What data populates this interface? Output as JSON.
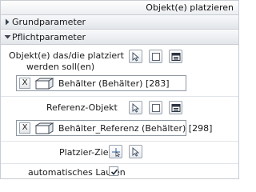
{
  "window": {
    "title": "Objekt(e) platzieren"
  },
  "sections": [
    {
      "label": "Grundparameter",
      "expanded": false
    },
    {
      "label": "Pflichtparameter",
      "expanded": true
    }
  ],
  "rows": {
    "objects": {
      "label_line1": "Objekt(e) das/die platziert",
      "label_line2": "werden soll(en)",
      "value": "Behälter (Behälter) [283]",
      "clear_label": "X"
    },
    "reference": {
      "label": "Referenz-Objekt",
      "value": "Behälter_Referenz (Behälter) [298]",
      "clear_label": "X"
    },
    "target": {
      "label": "Platzier-Ziel"
    },
    "auto_run": {
      "label": "automatisches Laufen",
      "checked": true
    }
  },
  "icons": [
    "select-pointer-icon",
    "rectangle-select-icon",
    "list-select-icon",
    "pick-point-icon",
    "object-box-icon",
    "checkmark-icon",
    "chevron-right-icon",
    "chevron-down-icon"
  ],
  "colors": {
    "border": "#c9cdd2",
    "header_gradient_end": "#e3e6ea"
  }
}
